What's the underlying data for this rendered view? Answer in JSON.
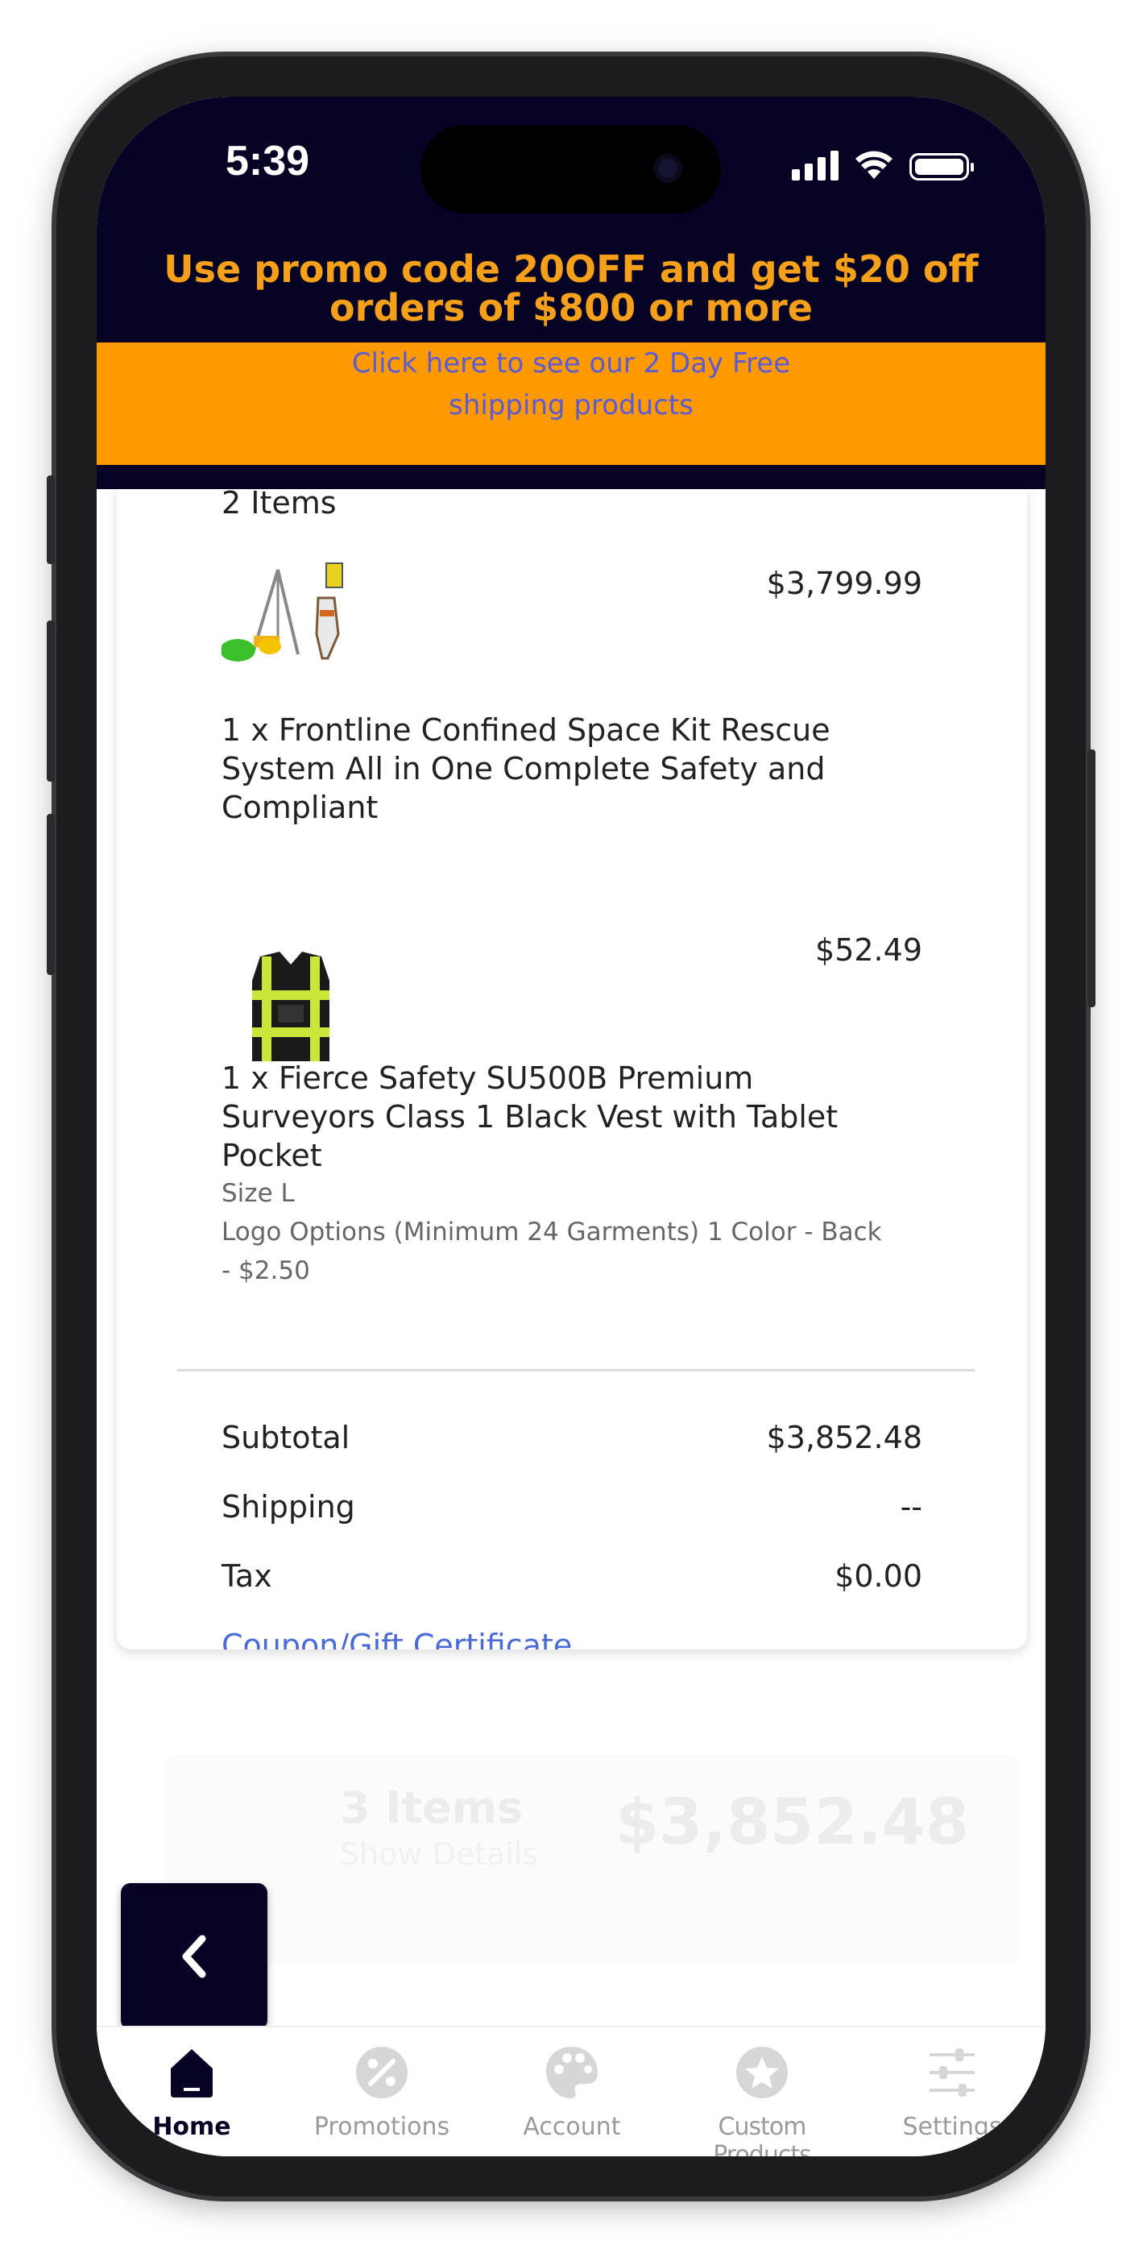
{
  "status_bar": {
    "time": "5:39"
  },
  "promo": {
    "text": "Use promo code 20OFF and get $20 off orders of $800 or more"
  },
  "shipping_banner": {
    "text": "Click here to see our 2 Day Free shipping products"
  },
  "cart": {
    "items_count": "2 Items",
    "items": [
      {
        "price": "$3,799.99",
        "name": "1 x Frontline Confined Space Kit Rescue System All in One Complete Safety and Compliant",
        "options": []
      },
      {
        "price": "$52.49",
        "name": "1 x Fierce Safety SU500B Premium Surveyors Class 1 Black Vest with Tablet Pocket",
        "options": [
          "Size L",
          "Logo Options (Minimum 24 Garments) 1 Color - Back - $2.50"
        ]
      }
    ],
    "summary": {
      "subtotal_label": "Subtotal",
      "subtotal_value": "$3,852.48",
      "shipping_label": "Shipping",
      "shipping_value": "--",
      "tax_label": "Tax",
      "tax_value": "$0.00",
      "coupon_link": "Coupon/Gift Certificate"
    }
  },
  "footer_summary": {
    "items": "3 Items",
    "show_details": "Show Details",
    "total": "$3,852.48"
  },
  "tabbar": {
    "tabs": [
      {
        "label": "Home",
        "icon": "home-icon",
        "active": true
      },
      {
        "label": "Promotions",
        "icon": "percent-icon",
        "active": false
      },
      {
        "label": "Account",
        "icon": "palette-icon",
        "active": false
      },
      {
        "label": "Custom Products",
        "icon": "star-icon",
        "active": false
      },
      {
        "label": "Settings",
        "icon": "sliders-icon",
        "active": false
      }
    ]
  },
  "colors": {
    "header_bg": "#070325",
    "promo_text": "#f5a01a",
    "banner_bg": "#ff9900",
    "link": "#4a6ad6"
  }
}
